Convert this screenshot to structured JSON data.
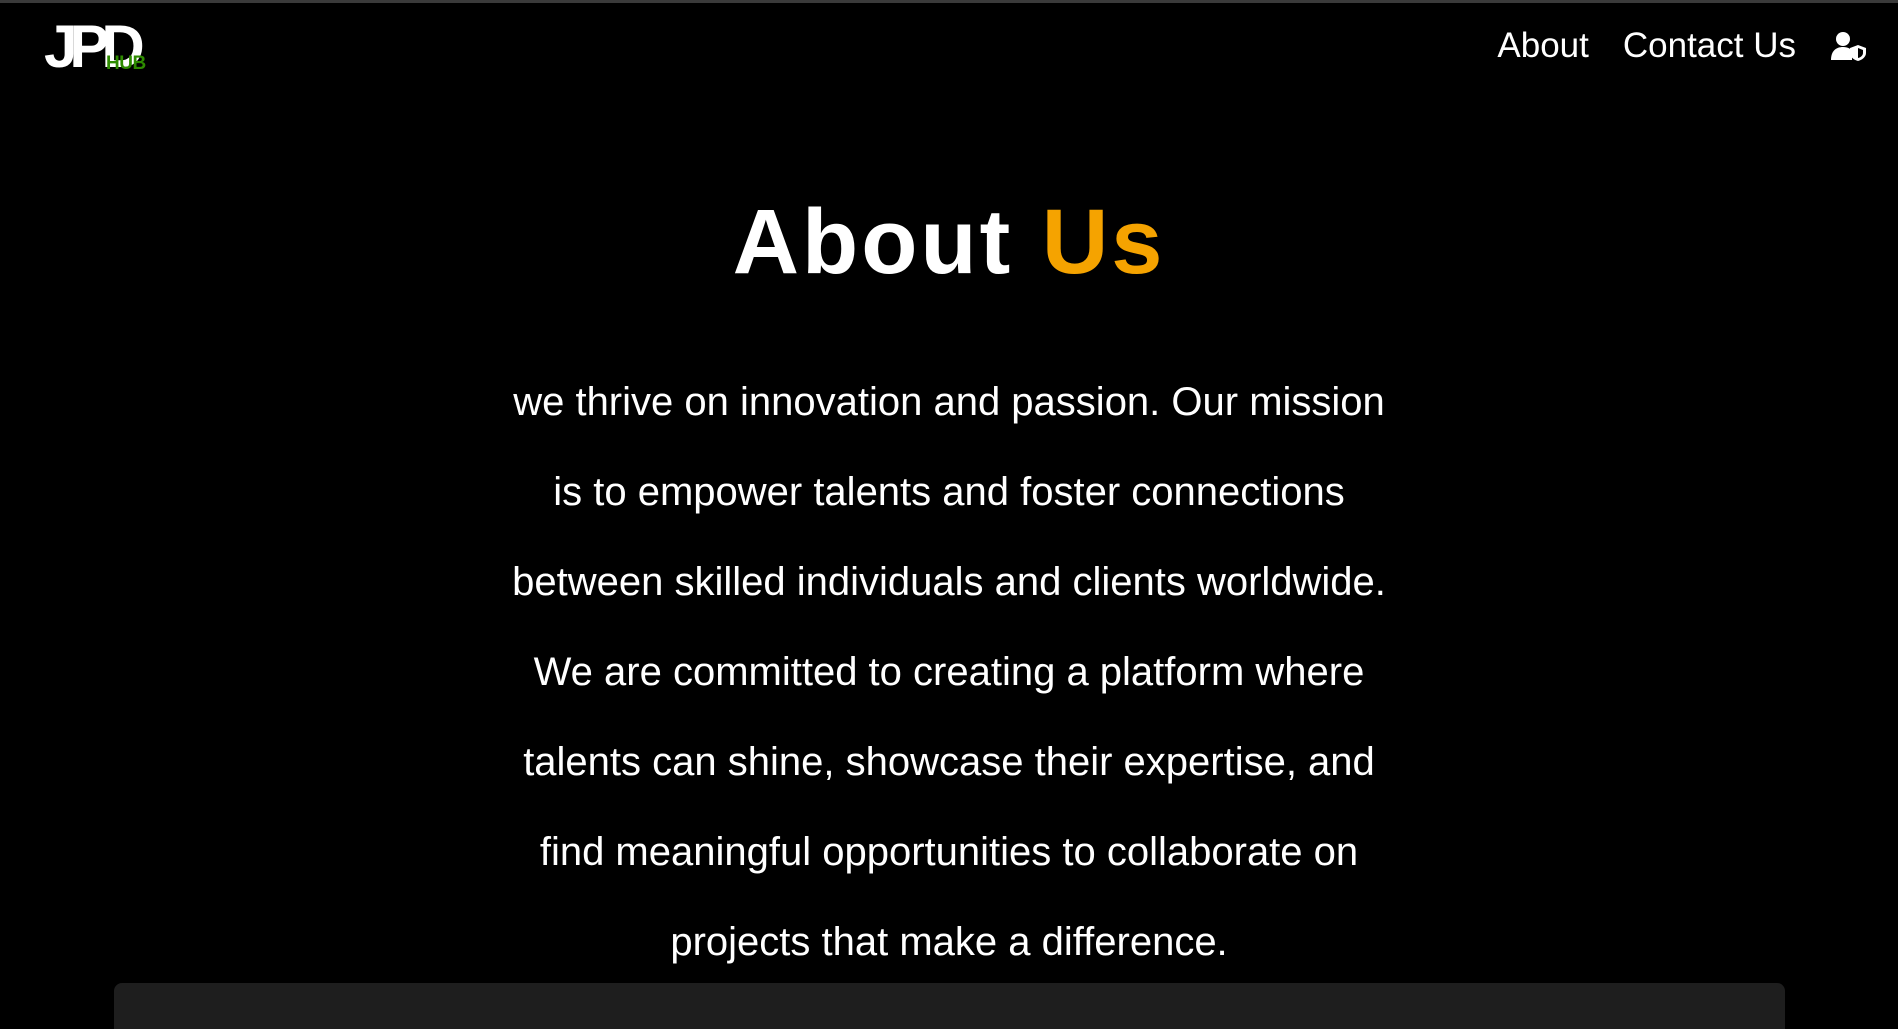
{
  "brand": {
    "logo_main": "JPD",
    "logo_sub": "HUB"
  },
  "nav": {
    "items": [
      {
        "label": "About"
      },
      {
        "label": "Contact Us"
      }
    ],
    "profile_icon": "user-shield-icon"
  },
  "main": {
    "heading_part1": "About",
    "heading_part2": "Us",
    "paragraph_lines": [
      "we thrive on innovation and passion. Our mission",
      "is to empower talents and foster connections",
      "between skilled individuals and clients worldwide.",
      "We are committed to creating a platform where",
      "talents can shine, showcase their expertise, and",
      "find meaningful opportunities to collaborate on",
      "projects that make a difference."
    ]
  },
  "colors": {
    "background": "#000000",
    "accent": "#f5a300",
    "logo_sub": "#2e8b00",
    "panel": "#1e1e1e"
  }
}
